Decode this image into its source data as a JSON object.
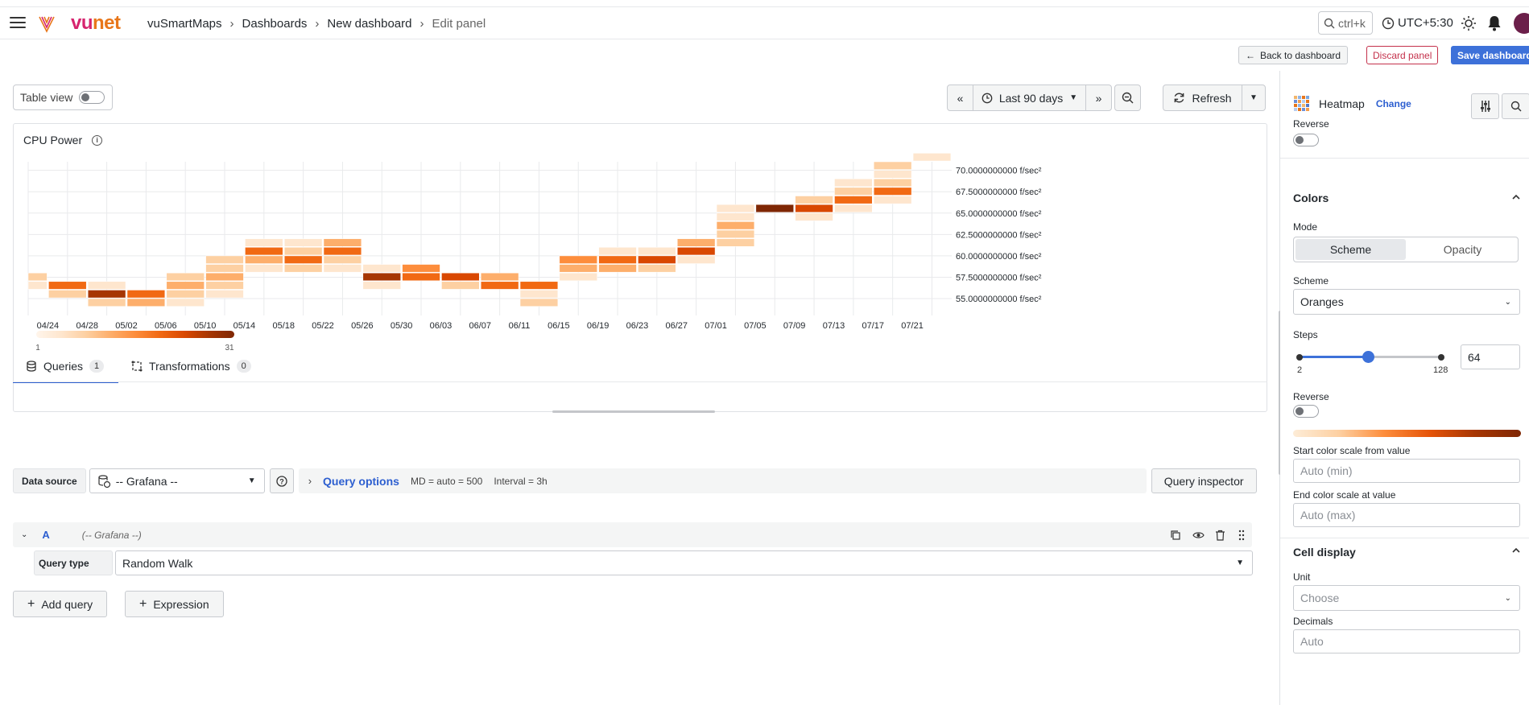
{
  "topbar": {
    "breadcrumb": [
      "vuSmartMaps",
      "Dashboards",
      "New dashboard",
      "Edit panel"
    ],
    "search_placeholder": "ctrl+k",
    "timezone": "UTC+5:30"
  },
  "actions": {
    "back": "Back to dashboard",
    "discard": "Discard panel",
    "save": "Save dashboard"
  },
  "toolbar": {
    "table_view": "Table view",
    "time_range": "Last 90 days",
    "refresh": "Refresh"
  },
  "panel": {
    "title": "CPU Power"
  },
  "chart_data": {
    "type": "heatmap",
    "title": "CPU Power",
    "x_ticks": [
      "04/24",
      "04/28",
      "05/02",
      "05/06",
      "05/10",
      "05/14",
      "05/18",
      "05/22",
      "05/26",
      "05/30",
      "06/03",
      "06/07",
      "06/11",
      "06/15",
      "06/19",
      "06/23",
      "06/27",
      "07/01",
      "07/05",
      "07/09",
      "07/13",
      "07/17",
      "07/21"
    ],
    "y_ticks": [
      "70.0000000000 f/sec²",
      "67.5000000000 f/sec²",
      "65.0000000000 f/sec²",
      "62.5000000000 f/sec²",
      "60.0000000000 f/sec²",
      "57.5000000000 f/sec²",
      "55.0000000000 f/sec²"
    ],
    "y_range": [
      53.5,
      71
    ],
    "color_scheme": "Oranges",
    "color_range": [
      1,
      31
    ],
    "legend_min": "1",
    "legend_max": "31",
    "bucket_height": 1,
    "columns": [
      {
        "x": "04/22",
        "cells": [
          [
            56.5,
            3
          ],
          [
            57.5,
            6
          ]
        ]
      },
      {
        "x": "04/26",
        "cells": [
          [
            55.5,
            6
          ],
          [
            56.5,
            17
          ]
        ]
      },
      {
        "x": "04/30",
        "cells": [
          [
            54.5,
            8
          ],
          [
            55.5,
            27
          ],
          [
            56.5,
            3
          ]
        ]
      },
      {
        "x": "05/04",
        "cells": [
          [
            54.5,
            11
          ],
          [
            55.5,
            20
          ]
        ]
      },
      {
        "x": "05/08",
        "cells": [
          [
            54.5,
            4
          ],
          [
            55.5,
            6
          ],
          [
            56.5,
            11
          ],
          [
            57.5,
            6
          ]
        ]
      },
      {
        "x": "05/12",
        "cells": [
          [
            55.5,
            3
          ],
          [
            56.5,
            6
          ],
          [
            57.5,
            11
          ],
          [
            58.5,
            6
          ],
          [
            59.5,
            5
          ]
        ]
      },
      {
        "x": "05/16",
        "cells": [
          [
            58.5,
            4
          ],
          [
            59.5,
            11
          ],
          [
            60.5,
            20
          ],
          [
            61.5,
            3
          ]
        ]
      },
      {
        "x": "05/20",
        "cells": [
          [
            58.5,
            6
          ],
          [
            59.5,
            20
          ],
          [
            60.5,
            6
          ],
          [
            61.5,
            3
          ]
        ]
      },
      {
        "x": "05/24",
        "cells": [
          [
            58.5,
            3
          ],
          [
            59.5,
            7
          ],
          [
            60.5,
            17
          ],
          [
            61.5,
            11
          ]
        ]
      },
      {
        "x": "05/28",
        "cells": [
          [
            56.5,
            3
          ],
          [
            57.5,
            27
          ],
          [
            58.5,
            3
          ]
        ]
      },
      {
        "x": "06/01",
        "cells": [
          [
            57.5,
            17
          ],
          [
            58.5,
            14
          ]
        ]
      },
      {
        "x": "06/05",
        "cells": [
          [
            56.5,
            8
          ],
          [
            57.5,
            23
          ]
        ]
      },
      {
        "x": "06/09",
        "cells": [
          [
            56.5,
            20
          ],
          [
            57.5,
            11
          ]
        ]
      },
      {
        "x": "06/13",
        "cells": [
          [
            54.5,
            6
          ],
          [
            55.5,
            3
          ],
          [
            56.5,
            17
          ]
        ]
      },
      {
        "x": "06/17",
        "cells": [
          [
            57.5,
            3
          ],
          [
            58.5,
            11
          ],
          [
            59.5,
            14
          ]
        ]
      },
      {
        "x": "06/21",
        "cells": [
          [
            58.5,
            11
          ],
          [
            59.5,
            20
          ],
          [
            60.5,
            3
          ]
        ]
      },
      {
        "x": "06/25",
        "cells": [
          [
            58.5,
            6
          ],
          [
            59.5,
            23
          ],
          [
            60.5,
            3
          ]
        ]
      },
      {
        "x": "06/29",
        "cells": [
          [
            59.5,
            3
          ],
          [
            60.5,
            23
          ],
          [
            61.5,
            11
          ]
        ]
      },
      {
        "x": "07/03",
        "cells": [
          [
            61.5,
            6
          ],
          [
            62.5,
            8
          ],
          [
            63.5,
            11
          ],
          [
            64.5,
            3
          ],
          [
            65.5,
            4
          ]
        ]
      },
      {
        "x": "07/07",
        "cells": [
          [
            65.5,
            31
          ]
        ]
      },
      {
        "x": "07/11",
        "cells": [
          [
            64.5,
            3
          ],
          [
            65.5,
            23
          ],
          [
            66.5,
            6
          ]
        ]
      },
      {
        "x": "07/15",
        "cells": [
          [
            65.5,
            4
          ],
          [
            66.5,
            20
          ],
          [
            67.5,
            6
          ],
          [
            68.5,
            3
          ]
        ]
      },
      {
        "x": "07/19",
        "cells": [
          [
            66.5,
            4
          ],
          [
            67.5,
            17
          ],
          [
            68.5,
            6
          ],
          [
            69.5,
            3
          ],
          [
            70.5,
            8
          ]
        ]
      },
      {
        "x": "07/22",
        "cells": [
          [
            71.5,
            3
          ]
        ]
      }
    ]
  },
  "tabs": [
    {
      "label": "Queries",
      "count": "1"
    },
    {
      "label": "Transformations",
      "count": "0"
    }
  ],
  "query_bar": {
    "ds_label": "Data source",
    "ds_value": "-- Grafana --",
    "options_label": "Query options",
    "md": "MD = auto = 500",
    "interval": "Interval = 3h",
    "inspector": "Query inspector"
  },
  "query": {
    "ref": "A",
    "source": "(-- Grafana --)",
    "type_label": "Query type",
    "type_value": "Random Walk"
  },
  "buttons": {
    "add_query": "Add query",
    "expression": "Expression"
  },
  "right_panel": {
    "viz_name": "Heatmap",
    "change": "Change",
    "reverse_top": "Reverse",
    "colors_section": "Colors",
    "mode_label": "Mode",
    "mode_options": [
      "Scheme",
      "Opacity"
    ],
    "scheme_label": "Scheme",
    "scheme_value": "Oranges",
    "steps_label": "Steps",
    "steps_min": "2",
    "steps_max": "128",
    "steps_value": "64",
    "steps_fraction": 0.49,
    "reverse_label": "Reverse",
    "start_label": "Start color scale from value",
    "start_placeholder": "Auto (min)",
    "end_label": "End color scale at value",
    "end_placeholder": "Auto (max)",
    "cell_section": "Cell display",
    "unit_label": "Unit",
    "unit_placeholder": "Choose",
    "decimals_label": "Decimals",
    "decimals_placeholder": "Auto"
  }
}
